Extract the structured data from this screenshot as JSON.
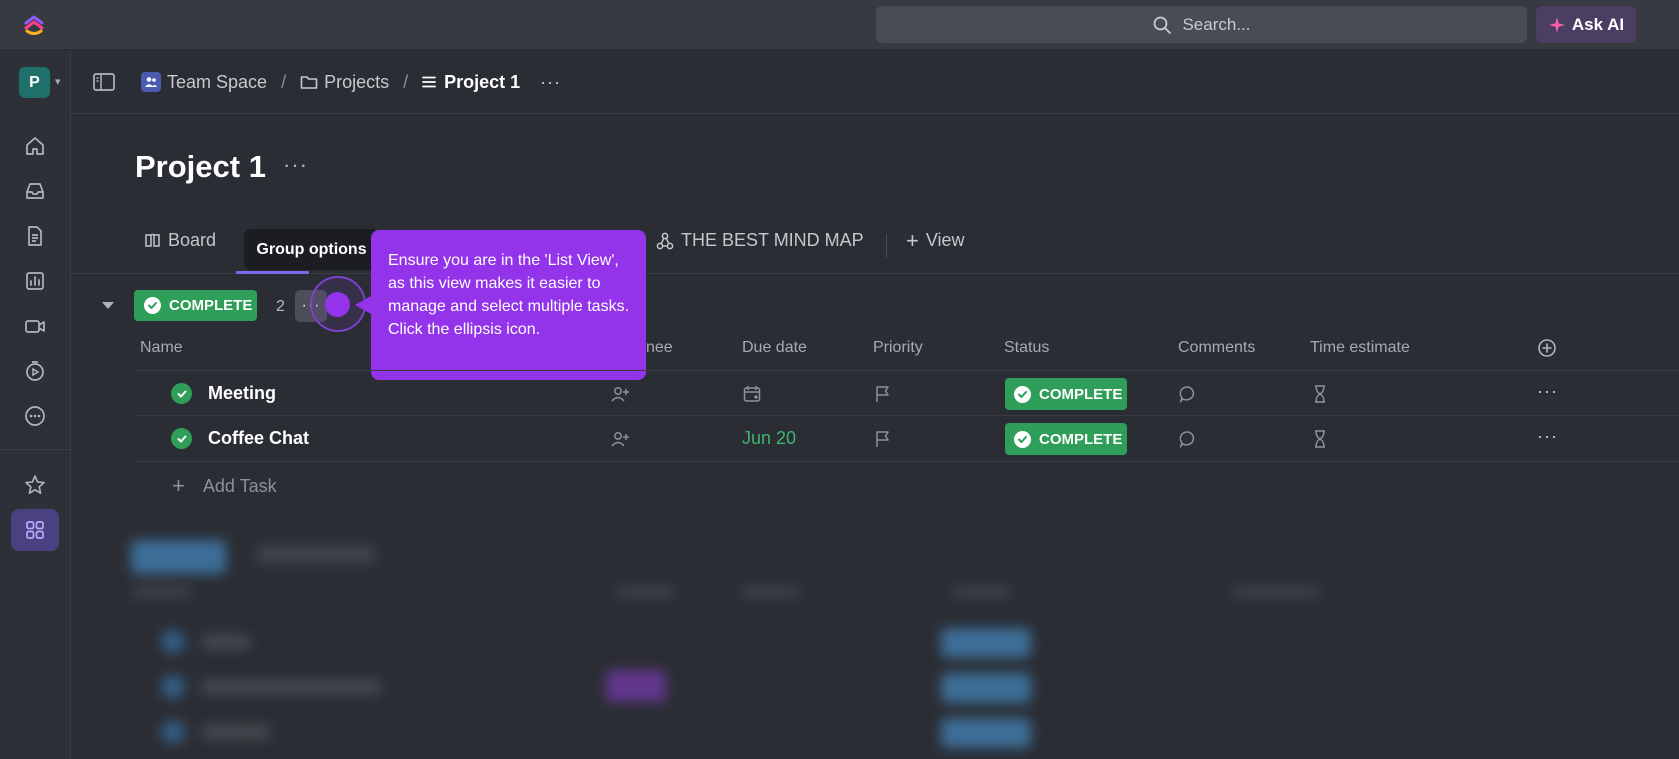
{
  "topbar": {
    "search_placeholder": "Search...",
    "ask_ai_label": "Ask AI"
  },
  "sidebar": {
    "workspace_initial": "P",
    "items": [
      "home-icon",
      "inbox-icon",
      "docs-icon",
      "dashboards-icon",
      "clips-icon",
      "timesheets-icon",
      "more-icon",
      "favorites-icon",
      "spaces-icon"
    ]
  },
  "breadcrumb": {
    "items": [
      {
        "label": "Team Space",
        "icon": "team-icon"
      },
      {
        "label": "Projects",
        "icon": "folder-icon"
      },
      {
        "label": "Project 1",
        "icon": "list-icon"
      }
    ],
    "separator": "/",
    "more": "···"
  },
  "page": {
    "title": "Project 1",
    "more": "···"
  },
  "tabs": {
    "board": "Board",
    "mind_map": "THE BEST MIND MAP",
    "add_view": "View",
    "plus": "+"
  },
  "tooltip": {
    "text": "Group options"
  },
  "callout": {
    "text": "Ensure you are in the 'List View', as this view makes it easier to manage and select multiple tasks. Click the ellipsis icon."
  },
  "group": {
    "status": "COMPLETE",
    "count": "2",
    "more": "···"
  },
  "columns": {
    "name": "Name",
    "assignee": "nee",
    "due_date": "Due date",
    "priority": "Priority",
    "status": "Status",
    "comments": "Comments",
    "time_estimate": "Time estimate"
  },
  "tasks": [
    {
      "name": "Meeting",
      "due": "",
      "status": "COMPLETE",
      "more": "···"
    },
    {
      "name": "Coffee Chat",
      "due": "Jun 20",
      "status": "COMPLETE",
      "more": "···"
    }
  ],
  "add_task": {
    "plus": "+",
    "label": "Add Task"
  },
  "colors": {
    "accent": "#7b68ee",
    "complete": "#2e9e58",
    "callout": "#9333ea",
    "due_green": "#3fb36f"
  }
}
